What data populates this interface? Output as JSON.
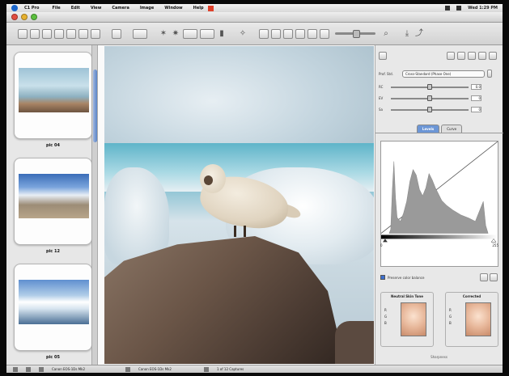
{
  "menubar": {
    "app_name": "C1 Pro",
    "items": [
      "File",
      "Edit",
      "View",
      "Camera",
      "Image",
      "Window",
      "Help"
    ],
    "clock": "Wed 1:29 PM"
  },
  "window": {
    "title": ""
  },
  "browser": {
    "thumbnails": [
      {
        "caption": "pic 04"
      },
      {
        "caption": "pic 12"
      },
      {
        "caption": "pic 05"
      }
    ]
  },
  "tools": {
    "profile_label": "Prof. Std.",
    "profile_value": "Cross-Standard (Phase One)",
    "sliders": [
      {
        "label": "RC",
        "value": "0.0",
        "level": 0.5
      },
      {
        "label": "EV",
        "value": "0",
        "level": 0.5
      },
      {
        "label": "Sa",
        "value": "0",
        "level": 0.5
      }
    ],
    "tabs": [
      "Levels",
      "Curve"
    ],
    "hist_low": "0",
    "hist_high": "255",
    "preserve_label": "Preserve color balance",
    "neutral": {
      "title": "Neutral Skin Tone",
      "rows": [
        "R",
        "G",
        "B"
      ]
    },
    "corrected": {
      "title": "Corrected",
      "rows": [
        "R",
        "G",
        "B"
      ]
    },
    "footer": "Sharpness"
  },
  "status": {
    "left": "Canon EOS-1Ds Mk2",
    "mid": "Canon EOS-1Ds Mk2",
    "count": "1 of 12 Captures"
  },
  "colors": {
    "accent": "#6c96d6",
    "close": "#e24c3f",
    "minimize": "#e7b12f",
    "zoom": "#5bbf3e"
  }
}
